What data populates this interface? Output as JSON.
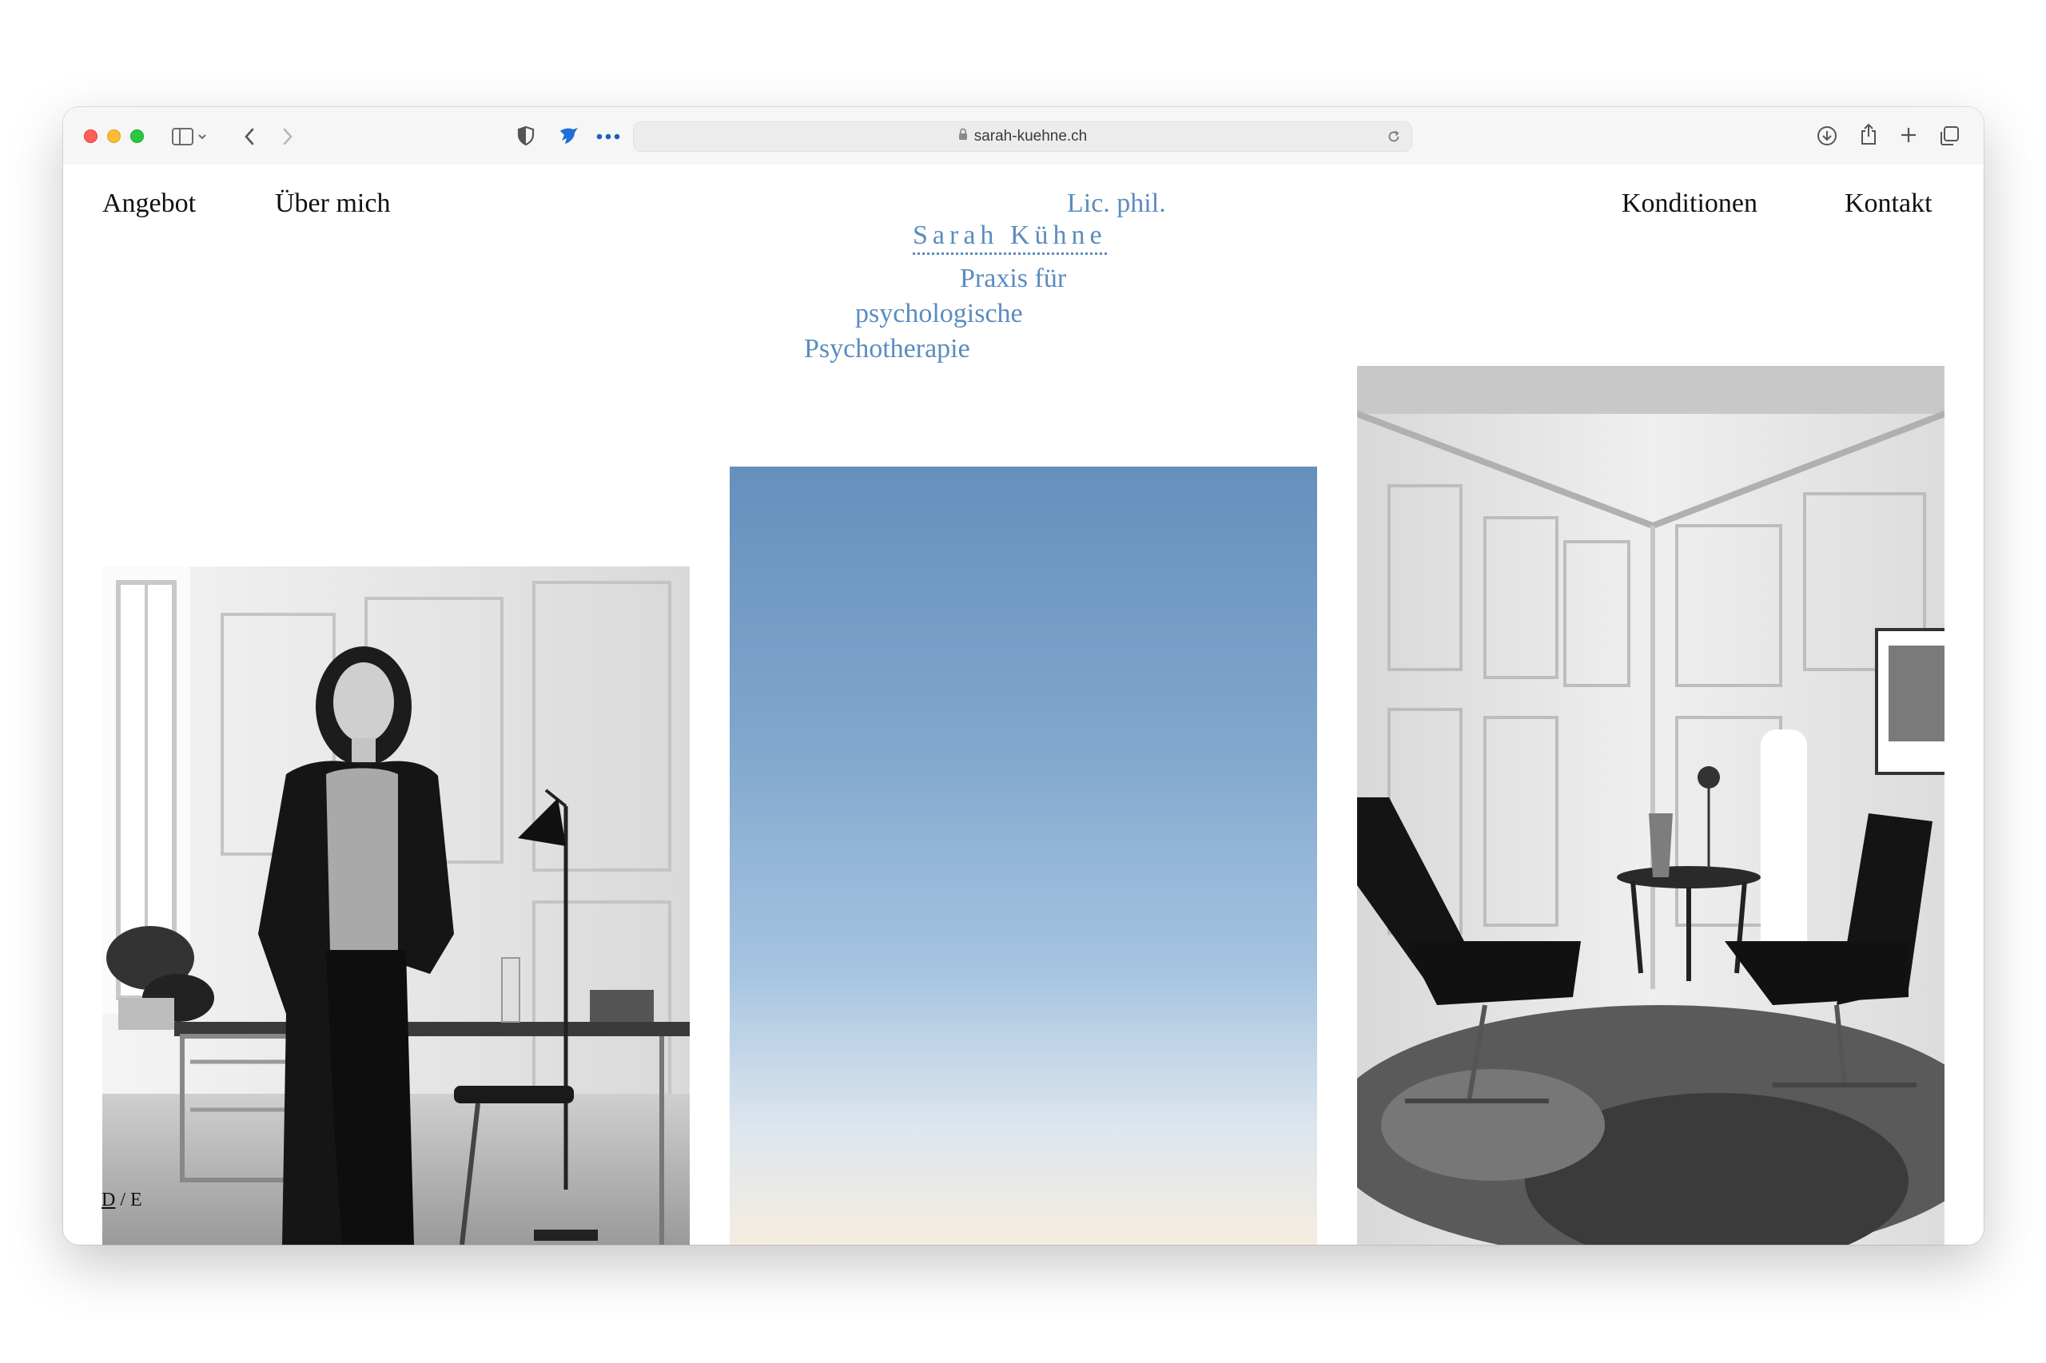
{
  "browser": {
    "url": "sarah-kuehne.ch",
    "icons": {
      "sidebar": "sidebar-icon",
      "back": "chevron-left-icon",
      "forward": "chevron-right-icon",
      "privacy": "shield-icon",
      "extension": "bird-extension-icon",
      "more": "ellipsis-icon",
      "lock": "lock-icon",
      "reload": "reload-icon",
      "download": "download-icon",
      "share": "share-icon",
      "new_tab": "plus-icon",
      "tabs": "tab-overview-icon"
    }
  },
  "nav": {
    "left": [
      "Angebot",
      "Über mich"
    ],
    "right": [
      "Konditionen",
      "Kontakt"
    ]
  },
  "logo": {
    "line1": "Lic. phil.",
    "name": "Sarah Kühne",
    "line3": "Praxis für",
    "line4": "psychologische",
    "line5": "Psychotherapie"
  },
  "language": {
    "de": "D",
    "separator": "/",
    "en": "E"
  },
  "colors": {
    "accent": "#5b8cbf",
    "text": "#111111",
    "sky_top": "#6590bd",
    "sky_bottom": "#f5ece0"
  }
}
